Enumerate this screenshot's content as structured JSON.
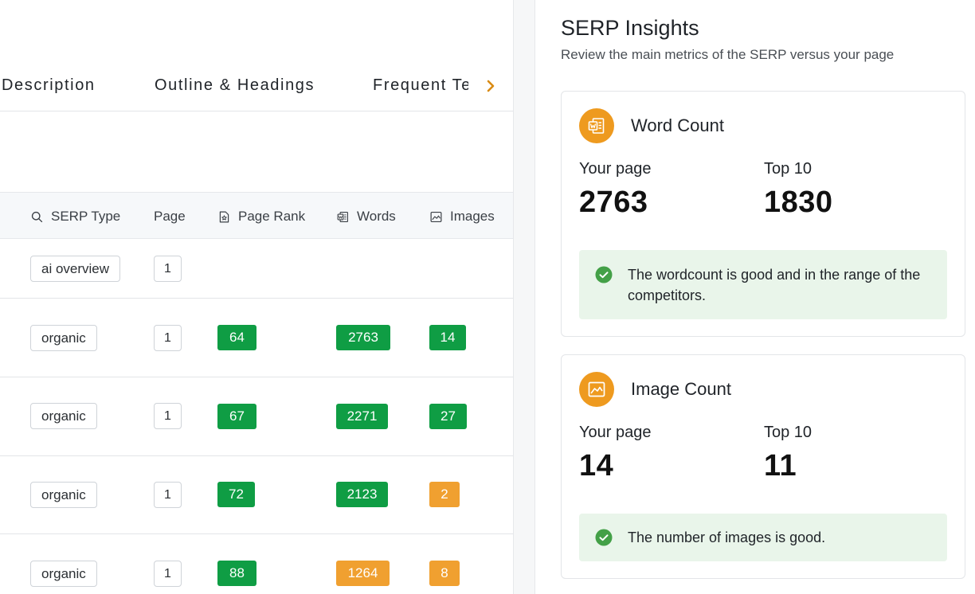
{
  "tabs": {
    "items": [
      "Description",
      "Outline & Headings",
      "Frequent Te"
    ],
    "next_icon": "chevron-right-icon",
    "accent": "#d98b14"
  },
  "table": {
    "headers": {
      "serp_type": "SERP Type",
      "page": "Page",
      "page_rank": "Page Rank",
      "words": "Words",
      "images": "Images"
    },
    "rows": [
      {
        "serp_type": "ai overview",
        "page": "1",
        "page_rank": "",
        "words": "",
        "images": ""
      },
      {
        "serp_type": "organic",
        "page": "1",
        "page_rank": "64",
        "words": "2763",
        "images": "14"
      },
      {
        "serp_type": "organic",
        "page": "1",
        "page_rank": "67",
        "words": "2271",
        "images": "27"
      },
      {
        "serp_type": "organic",
        "page": "1",
        "page_rank": "72",
        "words": "2123",
        "images": "2"
      },
      {
        "serp_type": "organic",
        "page": "1",
        "page_rank": "88",
        "words": "1264",
        "images": "8"
      }
    ],
    "colors": {
      "good": "#0f9d44",
      "warn": "#f0a030"
    }
  },
  "insights": {
    "title": "SERP Insights",
    "subtitle": "Review the main metrics of the SERP versus your page",
    "word_count": {
      "title": "Word Count",
      "your_page_label": "Your page",
      "your_page_value": "2763",
      "top10_label": "Top 10",
      "top10_value": "1830",
      "note": "The wordcount is good and in the range of the competitors."
    },
    "image_count": {
      "title": "Image Count",
      "your_page_label": "Your page",
      "your_page_value": "14",
      "top10_label": "Top 10",
      "top10_value": "11",
      "note": "The number of images is good."
    },
    "accent": "#ee9a1f",
    "success": "#43a047"
  }
}
